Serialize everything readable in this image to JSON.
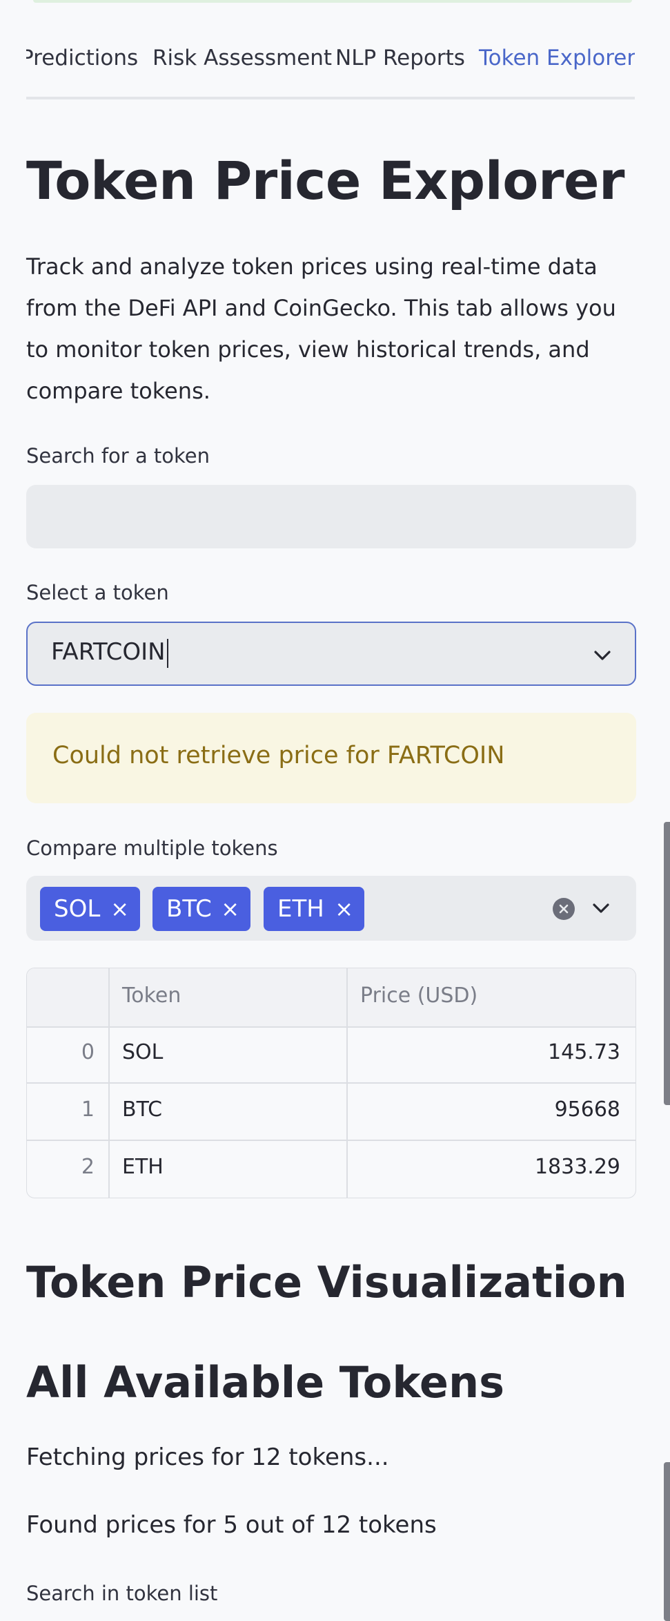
{
  "tabs": [
    {
      "label": "Predictions",
      "active": false
    },
    {
      "label": "Risk Assessment",
      "active": false
    },
    {
      "label": "NLP Reports",
      "active": false
    },
    {
      "label": "Token Explorer",
      "active": true
    }
  ],
  "page": {
    "title": "Token Price Explorer",
    "description": "Track and analyze token prices using real-time data from the DeFi API and CoinGecko. This tab allows you to monitor token prices, view historical trends, and compare tokens."
  },
  "search": {
    "label": "Search for a token",
    "value": "",
    "placeholder": ""
  },
  "select": {
    "label": "Select a token",
    "value": "FARTCOIN"
  },
  "warning": {
    "text": "Could not retrieve price for FARTCOIN"
  },
  "compare": {
    "label": "Compare multiple tokens",
    "chips": [
      "SOL",
      "BTC",
      "ETH"
    ],
    "remove_glyph": "×"
  },
  "table": {
    "columns": [
      "",
      "Token",
      "Price (USD)"
    ],
    "rows": [
      {
        "index": "0",
        "token": "SOL",
        "price": "145.73"
      },
      {
        "index": "1",
        "token": "BTC",
        "price": "95668"
      },
      {
        "index": "2",
        "token": "ETH",
        "price": "1833.29"
      }
    ]
  },
  "viz": {
    "heading": "Token Price Visualization"
  },
  "all_tokens": {
    "heading": "All Available Tokens",
    "fetching_text": "Fetching prices for 12 tokens...",
    "found_text": "Found prices for 5 out of 12 tokens",
    "search_label": "Search in token list"
  },
  "icons": {
    "chevron": "chevron-down-icon",
    "chip_remove": "close-icon",
    "clear_all": "clear-circle-icon"
  },
  "colors": {
    "accent": "#4a67c9",
    "chip": "#4a5fe0",
    "warning_bg": "#f9f6e3",
    "warning_text": "#8a6d15"
  }
}
